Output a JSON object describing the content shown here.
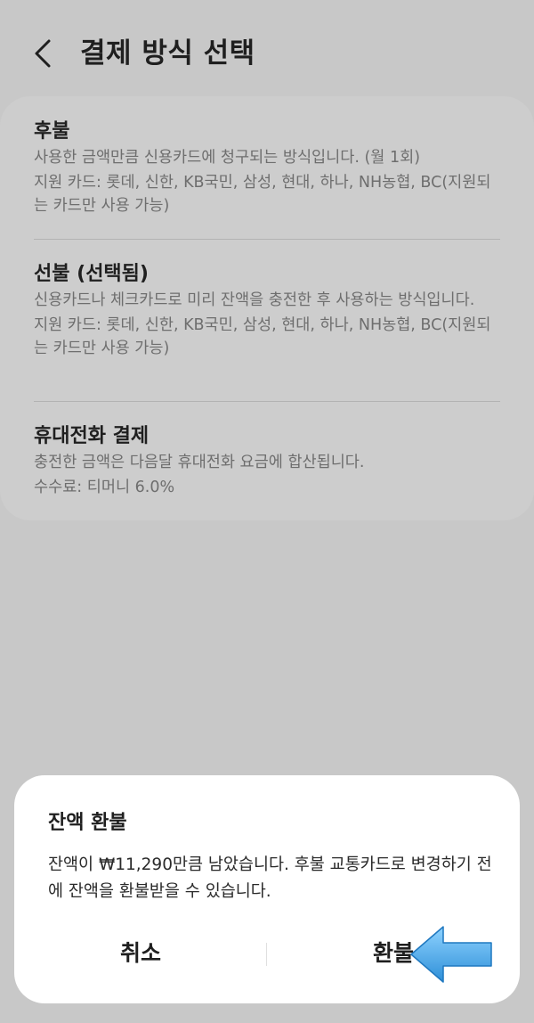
{
  "header": {
    "title": "결제 방식 선택",
    "back_icon": "chevron-left-icon"
  },
  "options": [
    {
      "title": "후불",
      "desc1": "사용한 금액만큼 신용카드에 청구되는 방식입니다. (월 1회)",
      "desc2": "지원 카드: 롯데, 신한, KB국민, 삼성, 현대, 하나, NH농협, BC(지원되는 카드만 사용 가능)"
    },
    {
      "title": "선불 (선택됨)",
      "desc1": "신용카드나 체크카드로 미리 잔액을 충전한 후 사용하는 방식입니다.",
      "desc2": "지원 카드: 롯데, 신한, KB국민, 삼성, 현대, 하나, NH농협, BC(지원되는 카드만 사용 가능)"
    },
    {
      "title": "휴대전화 결제",
      "desc1": "충전한 금액은 다음달 휴대전화 요금에 합산됩니다.",
      "desc2": "수수료: 티머니 6.0%"
    }
  ],
  "dialog": {
    "title": "잔액 환불",
    "message": "잔액이 ₩11,290만큼 남았습니다. 후불 교통카드로 변경하기 전에 잔액을 환불받을 수 있습니다.",
    "cancel_label": "취소",
    "refund_label": "환불"
  },
  "colors": {
    "background": "#c8c8c8",
    "card": "#cdcdcd",
    "dialog": "#ffffff",
    "arrow": "#4aa8e8"
  }
}
